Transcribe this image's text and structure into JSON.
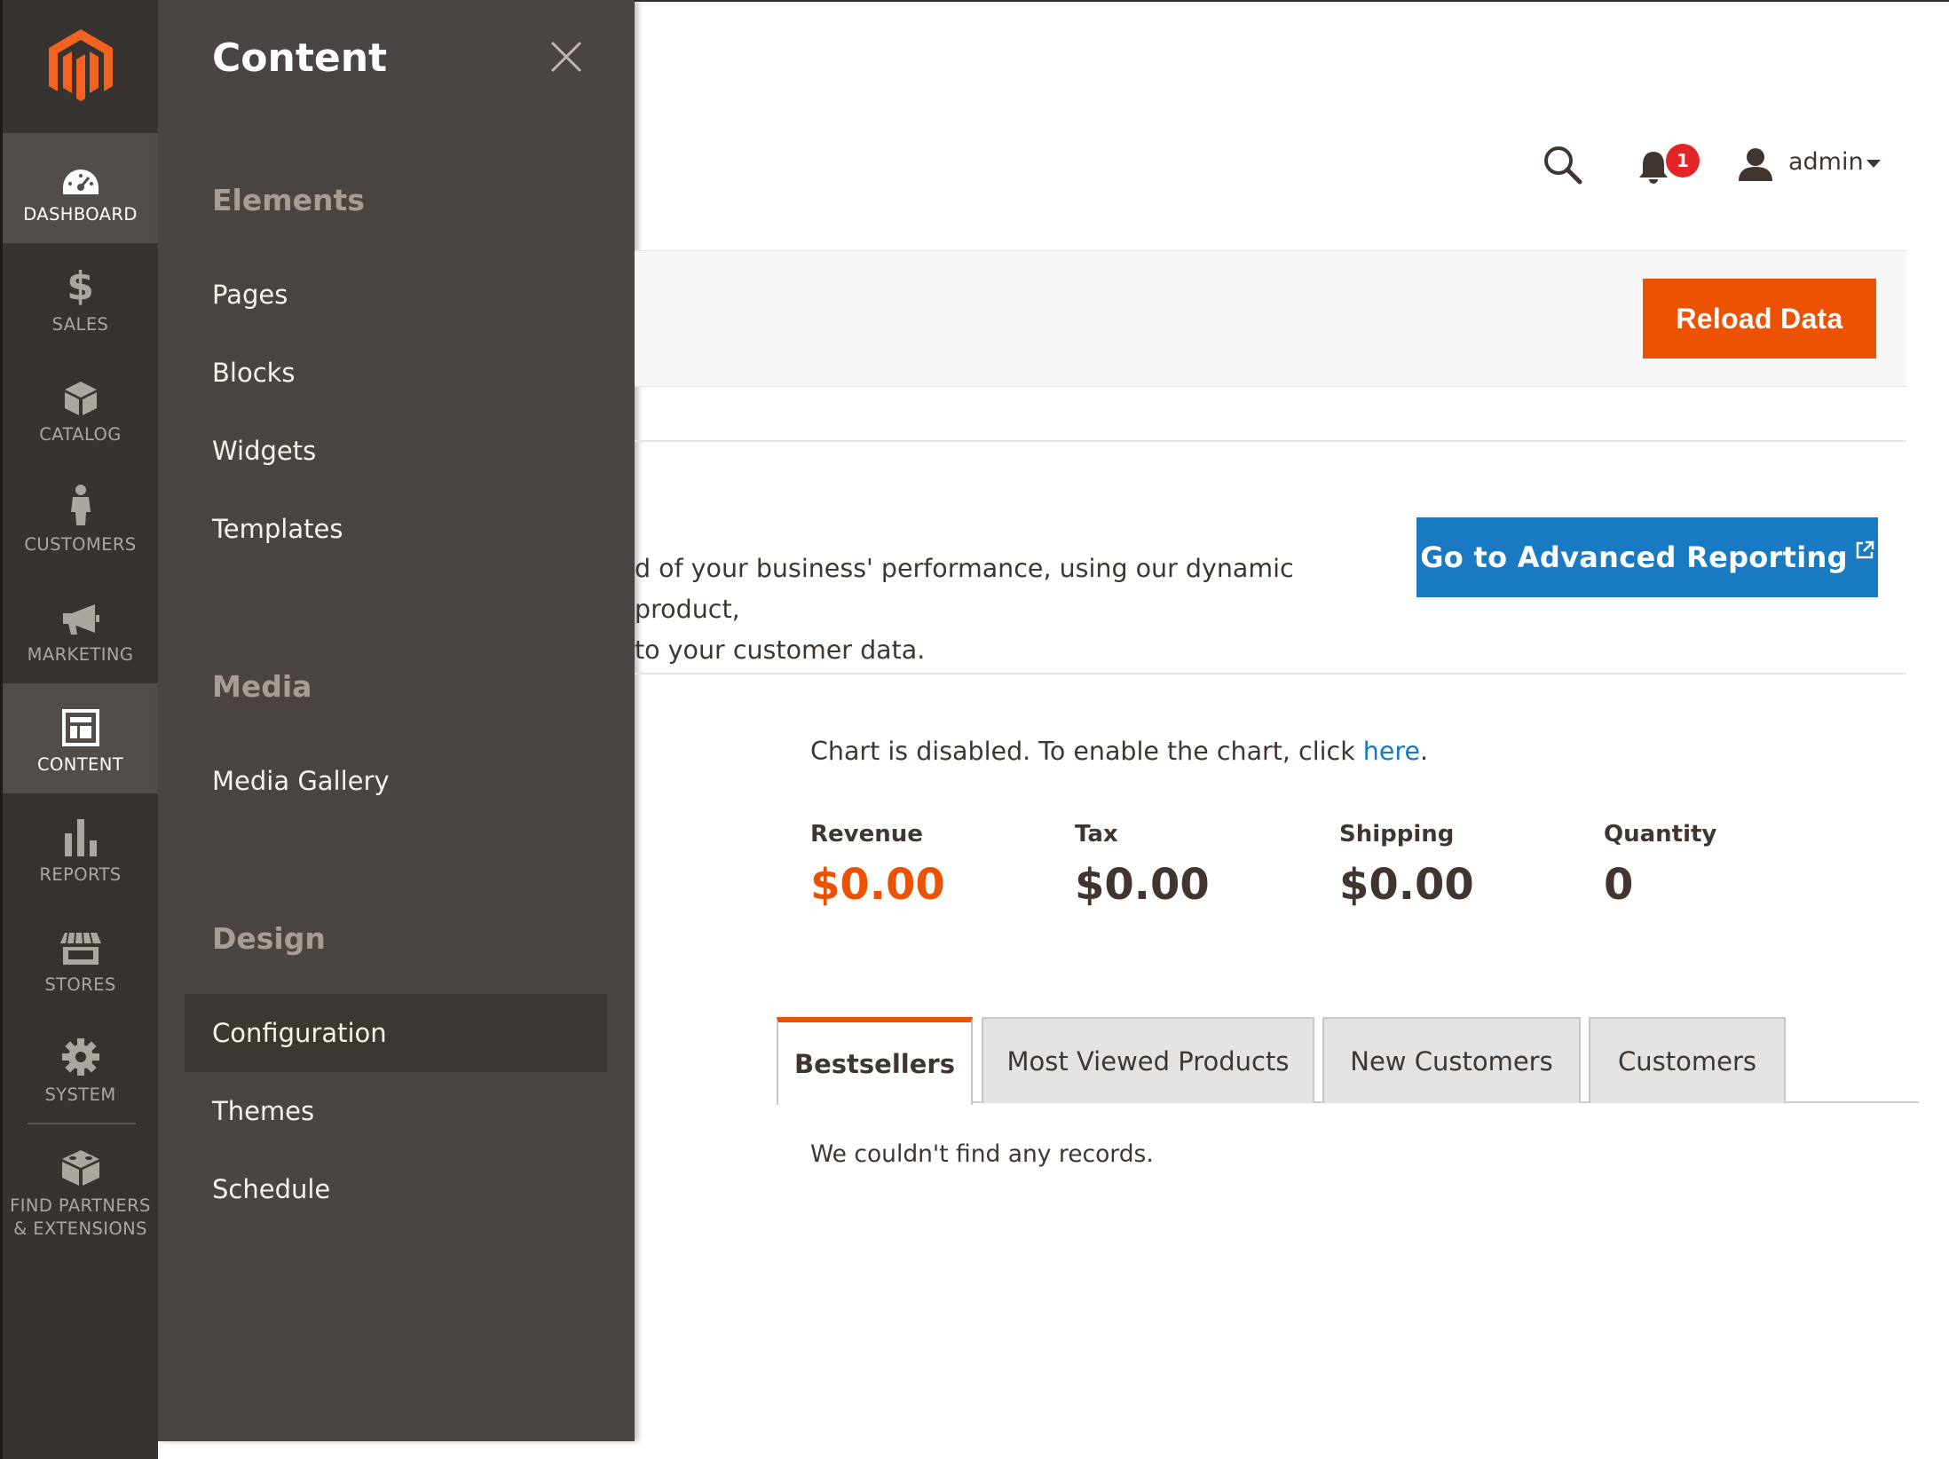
{
  "sidebar": {
    "logo_icon": "magento-logo-icon",
    "items": [
      {
        "label": "DASHBOARD",
        "icon": "dashboard-icon"
      },
      {
        "label": "SALES",
        "icon": "dollar-icon"
      },
      {
        "label": "CATALOG",
        "icon": "box-icon"
      },
      {
        "label": "CUSTOMERS",
        "icon": "person-icon"
      },
      {
        "label": "MARKETING",
        "icon": "megaphone-icon"
      },
      {
        "label": "CONTENT",
        "icon": "layout-icon"
      },
      {
        "label": "REPORTS",
        "icon": "bar-chart-icon"
      },
      {
        "label": "STORES",
        "icon": "store-icon"
      },
      {
        "label": "SYSTEM",
        "icon": "gear-icon"
      },
      {
        "label": "FIND PARTNERS\n& EXTENSIONS",
        "icon": "blocks-icon"
      }
    ]
  },
  "flyout": {
    "title": "Content",
    "sections": [
      {
        "title": "Elements",
        "links": [
          "Pages",
          "Blocks",
          "Widgets",
          "Templates"
        ]
      },
      {
        "title": "Media",
        "links": [
          "Media Gallery"
        ]
      },
      {
        "title": "Design",
        "links": [
          "Configuration",
          "Themes",
          "Schedule"
        ]
      }
    ]
  },
  "header": {
    "notification_count": "1",
    "user_name": "admin"
  },
  "actions": {
    "reload_label": "Reload Data"
  },
  "promo": {
    "text": "d of your business' performance, using our dynamic product,\n to your customer data.",
    "button_label": "Go to Advanced Reporting"
  },
  "chart": {
    "message_prefix": "Chart is disabled. To enable the chart, click ",
    "link_text": "here",
    "message_suffix": "."
  },
  "totals": [
    {
      "label": "Revenue",
      "value": "$0.00"
    },
    {
      "label": "Tax",
      "value": "$0.00"
    },
    {
      "label": "Shipping",
      "value": "$0.00"
    },
    {
      "label": "Quantity",
      "value": "0"
    }
  ],
  "tabs": [
    "Bestsellers",
    "Most Viewed Products",
    "New Customers",
    "Customers"
  ],
  "grid": {
    "empty_message": "We couldn't find any records."
  },
  "colors": {
    "accent_orange": "#eb5202",
    "link_blue": "#1979c3",
    "sidebar_bg": "#373330",
    "flyout_bg": "#4a4542"
  }
}
